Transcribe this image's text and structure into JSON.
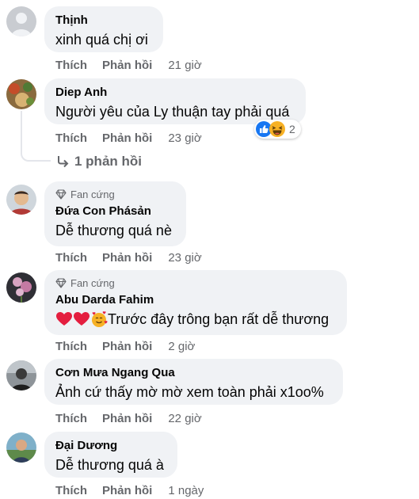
{
  "actions": {
    "like": "Thích",
    "reply": "Phản hồi"
  },
  "badge_label": "Fan cứng",
  "comments": [
    {
      "name": "Thịnh",
      "text": "xinh quá chị ơi",
      "time": "21 giờ"
    },
    {
      "name": "Diep Anh",
      "text": "Người yêu của Ly thuận tay phải quá",
      "time": "23 giờ",
      "reaction_count": "2",
      "reaction_icons": [
        "like-icon",
        "laughing-icon"
      ]
    },
    {
      "name": "Đứa Con Phásản",
      "text": "Dễ thương quá nè",
      "time": "23 giờ"
    },
    {
      "name": "Abu Darda Fahim",
      "text": "Trước đây trông bạn rất dễ thương",
      "emoji_prefix": [
        "heart-icon",
        "heart-icon",
        "smiling-hearts-icon"
      ],
      "time": "2 giờ"
    },
    {
      "name": "Cơn Mưa Ngang Qua",
      "text": "Ảnh cứ thấy mờ mờ xem toàn phải x1oo%",
      "time": "22 giờ"
    },
    {
      "name": "Đại Dương",
      "text": "Dễ thương quá à",
      "time": "1 ngày"
    }
  ],
  "reply_link": "1 phản hồi",
  "colors": {
    "bubble": "#f0f2f5",
    "secondary_text": "#65676b",
    "like_blue": "#1877f2",
    "heart_red": "#e41e3f"
  }
}
